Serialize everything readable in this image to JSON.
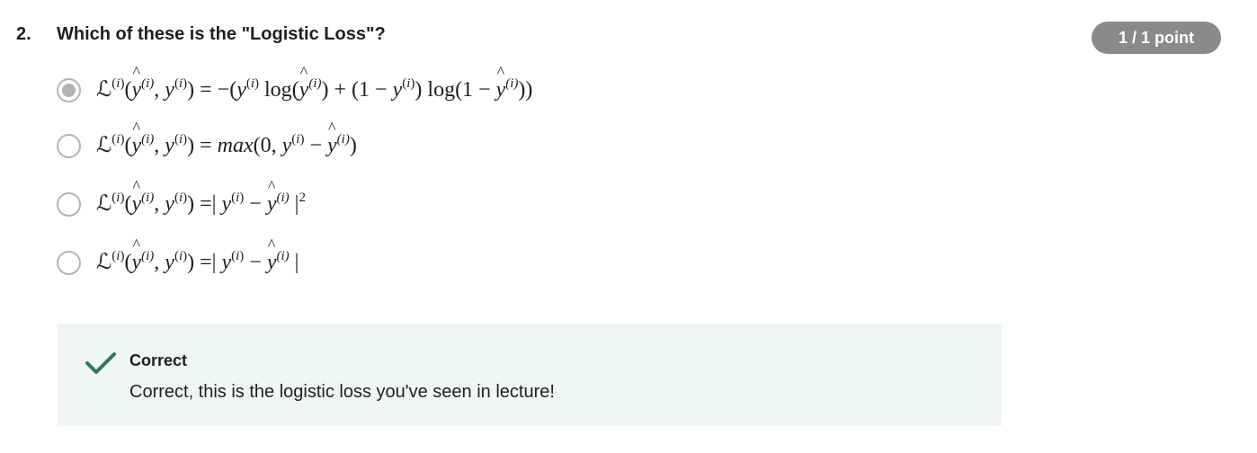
{
  "question": {
    "number": "2.",
    "text": "Which of these is the \"Logistic Loss\"?",
    "points": "1 / 1 point"
  },
  "options": [
    {
      "selected": true,
      "lhs": "ℒ",
      "expr": "ℒ^(i)(ŷ^(i), y^(i)) = −(y^(i) log(ŷ^(i)) + (1 − y^(i)) log(1 − ŷ^(i)))"
    },
    {
      "selected": false,
      "expr": "ℒ^(i)(ŷ^(i), y^(i)) = max(0, y^(i) − ŷ^(i))"
    },
    {
      "selected": false,
      "expr": "ℒ^(i)(ŷ^(i), y^(i)) =| y^(i) − ŷ^(i) |^2"
    },
    {
      "selected": false,
      "expr": "ℒ^(i)(ŷ^(i), y^(i)) =| y^(i) − ŷ^(i) |"
    }
  ],
  "feedback": {
    "status": "Correct",
    "message": "Correct, this is the logistic loss you've seen in lecture!",
    "icon": "checkmark-icon",
    "color": "#2d7a57"
  }
}
